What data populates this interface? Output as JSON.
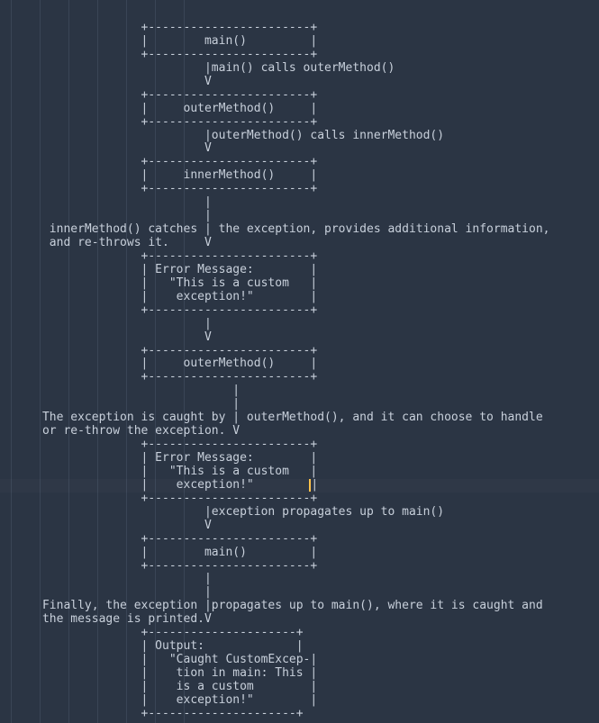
{
  "indent_positions": [
    12,
    44,
    76,
    108,
    140,
    172,
    204
  ],
  "code_lines": [
    "                    +-----------------------+",
    "                    |        main()         |",
    "                    +-----------------------+",
    "                             |main() calls outerMethod()",
    "                             V",
    "                    +-----------------------+",
    "                    |     outerMethod()     |",
    "                    +-----------------------+",
    "                             |outerMethod() calls innerMethod()",
    "                             V",
    "                    +-----------------------+",
    "                    |     innerMethod()     |",
    "                    +-----------------------+",
    "                             |",
    "                             |",
    "       innerMethod() catches | the exception, provides additional information,",
    "       and re-throws it.     V",
    "                    +-----------------------+",
    "                    | Error Message:        |",
    "                    |   \"This is a custom   |",
    "                    |    exception!\"        |",
    "                    +-----------------------+",
    "                             |",
    "                             V",
    "                    +-----------------------+",
    "                    |     outerMethod()     |",
    "                    +-----------------------+",
    "                                 |",
    "                                 |",
    "      The exception is caught by | outerMethod(), and it can choose to handle",
    "      or re-throw the exception. V",
    "                    +-----------------------+",
    "                    | Error Message:        |",
    "                    |   \"This is a custom   |",
    "                    |    exception!\"        ",
    "                    +-----------------------+",
    "                             |exception propagates up to main()",
    "                             V",
    "                    +-----------------------+",
    "                    |        main()         |",
    "                    +-----------------------+",
    "                             |",
    "                             |",
    "      Finally, the exception |propagates up to main(), where it is caught and",
    "      the message is printed.V",
    "                    +---------------------+",
    "                    | Output:             |",
    "                    |   \"Caught CustomExcep-|",
    "                    |    tion in main: This |",
    "                    |    is a custom        |",
    "                    |    exception!\"        |",
    "                    +---------------------+"
  ],
  "cursor_line_index": 34,
  "colors": {
    "background": "#2b3544",
    "text": "#c8d0db",
    "cursor": "#ffc24b",
    "indent_guide": "#3a4556"
  }
}
